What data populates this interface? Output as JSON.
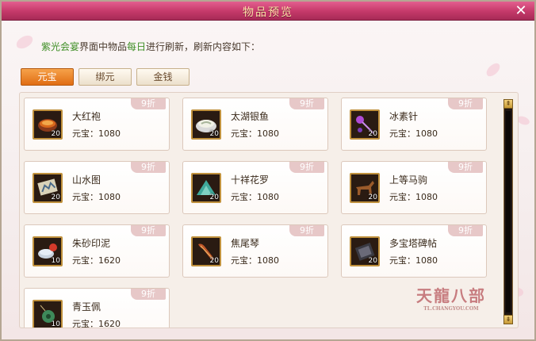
{
  "window": {
    "title": "物品预览"
  },
  "info": {
    "part1": "紫光会宴",
    "part2": "界面中物品",
    "part3": "每日",
    "part4": "进行刷新，刷新内容如下："
  },
  "tabs": [
    {
      "label": "元宝",
      "active": true
    },
    {
      "label": "绑元",
      "active": false
    },
    {
      "label": "金钱",
      "active": false
    }
  ],
  "items": [
    {
      "name": "大红袍",
      "price": "元宝：1080",
      "qty": "20",
      "discount": "9折",
      "icon": "tea-bowl-icon"
    },
    {
      "name": "太湖银鱼",
      "price": "元宝：1080",
      "qty": "20",
      "discount": "9折",
      "icon": "fish-bowl-icon"
    },
    {
      "name": "冰素针",
      "price": "元宝：1080",
      "qty": "20",
      "discount": "9折",
      "icon": "needle-icon"
    },
    {
      "name": "山水图",
      "price": "元宝：1080",
      "qty": "20",
      "discount": "9折",
      "icon": "painting-scroll-icon"
    },
    {
      "name": "十祥花罗",
      "price": "元宝：1080",
      "qty": "20",
      "discount": "9折",
      "icon": "silk-cloth-icon"
    },
    {
      "name": "上等马驹",
      "price": "元宝：1080",
      "qty": "20",
      "discount": "9折",
      "icon": "horse-icon"
    },
    {
      "name": "朱砂印泥",
      "price": "元宝：1620",
      "qty": "10",
      "discount": "9折",
      "icon": "ink-pad-icon"
    },
    {
      "name": "焦尾琴",
      "price": "元宝：1080",
      "qty": "20",
      "discount": "9折",
      "icon": "zither-icon"
    },
    {
      "name": "多宝塔碑帖",
      "price": "元宝：1080",
      "qty": "20",
      "discount": "9折",
      "icon": "stele-book-icon"
    },
    {
      "name": "青玉佩",
      "price": "元宝：1620",
      "qty": "10",
      "discount": "9折",
      "icon": "jade-pendant-icon"
    }
  ],
  "scrollbar": {
    "up": "⇞",
    "down": "⇟"
  },
  "watermark": {
    "text": "天龍八部",
    "sub": "TL.CHANGYOU.COM"
  }
}
